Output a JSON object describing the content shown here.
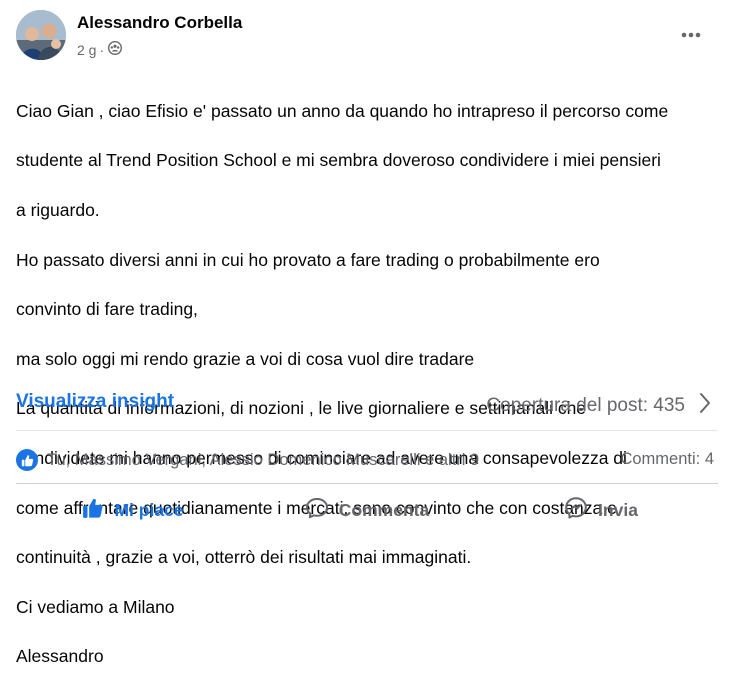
{
  "post": {
    "author": "Alessandro Corbella",
    "time": "2 g",
    "separator": "·",
    "privacy_icon": "group-icon",
    "more_icon": "more-horizontal-icon",
    "body_lines": [
      "Ciao Gian , ciao Efisio e' passato un anno da quando ho intrapreso il percorso come",
      "studente al Trend Position School e mi sembra doveroso condividere i miei pensieri",
      "a riguardo.",
      "Ho passato diversi anni in cui ho provato a fare trading o probabilmente ero",
      "convinto di fare trading,",
      "ma solo oggi mi rendo grazie a voi di cosa vuol dire tradare",
      "La quantità di informazioni, di nozioni , le live giornaliere e settimanali che",
      "condividete mi hanno permesso di cominciare ad avere una consapevolezza di",
      "come affrontare quotidianamente i mercati, sono convinto che con costanza e",
      "continuità , grazie a voi, otterrò dei risultati mai immaginati.",
      "Ci vediamo a Milano",
      "Alessandro"
    ]
  },
  "insights": {
    "link_label": "Visualizza insight",
    "coverage_label": "Copertura del post: 435",
    "chevron_icon": "chevron-right-icon"
  },
  "reactions": {
    "icon": "like-reaction-icon",
    "summary": "Tu, Massimo Vergani, Alessio Domenico Muscarelli e altri 9",
    "comments": "Commenti: 4"
  },
  "actions": {
    "like": "Mi piace",
    "comment": "Commenta",
    "share": "Invia"
  },
  "colors": {
    "accent": "#1b74e4",
    "secondary_text": "#65676b"
  }
}
